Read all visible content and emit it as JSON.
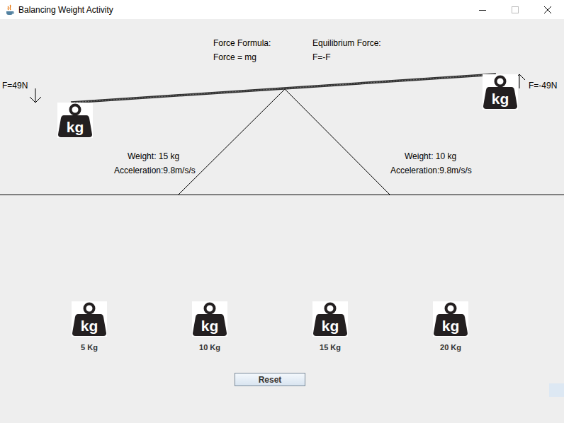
{
  "window": {
    "title": "Balancing Weight Activity"
  },
  "formulas": [
    {
      "label": "Force Formula:",
      "value": "Force = mg"
    },
    {
      "label": "Equilibrium Force:",
      "value": "F=-F"
    }
  ],
  "seesaw": {
    "left": {
      "force": "F=49N",
      "direction": "down",
      "weight": "Weight: 15 kg",
      "acceleration": "Acceleration:9.8m/s/s"
    },
    "right": {
      "force": "F=-49N",
      "direction": "up",
      "weight": "Weight: 10 kg",
      "acceleration": "Acceleration:9.8m/s/s"
    }
  },
  "weight_icon_label": "kg",
  "weights": [
    {
      "label": "5 Kg"
    },
    {
      "label": "10 Kg"
    },
    {
      "label": "15 Kg"
    },
    {
      "label": "20 Kg"
    }
  ],
  "buttons": [
    "Reset"
  ]
}
